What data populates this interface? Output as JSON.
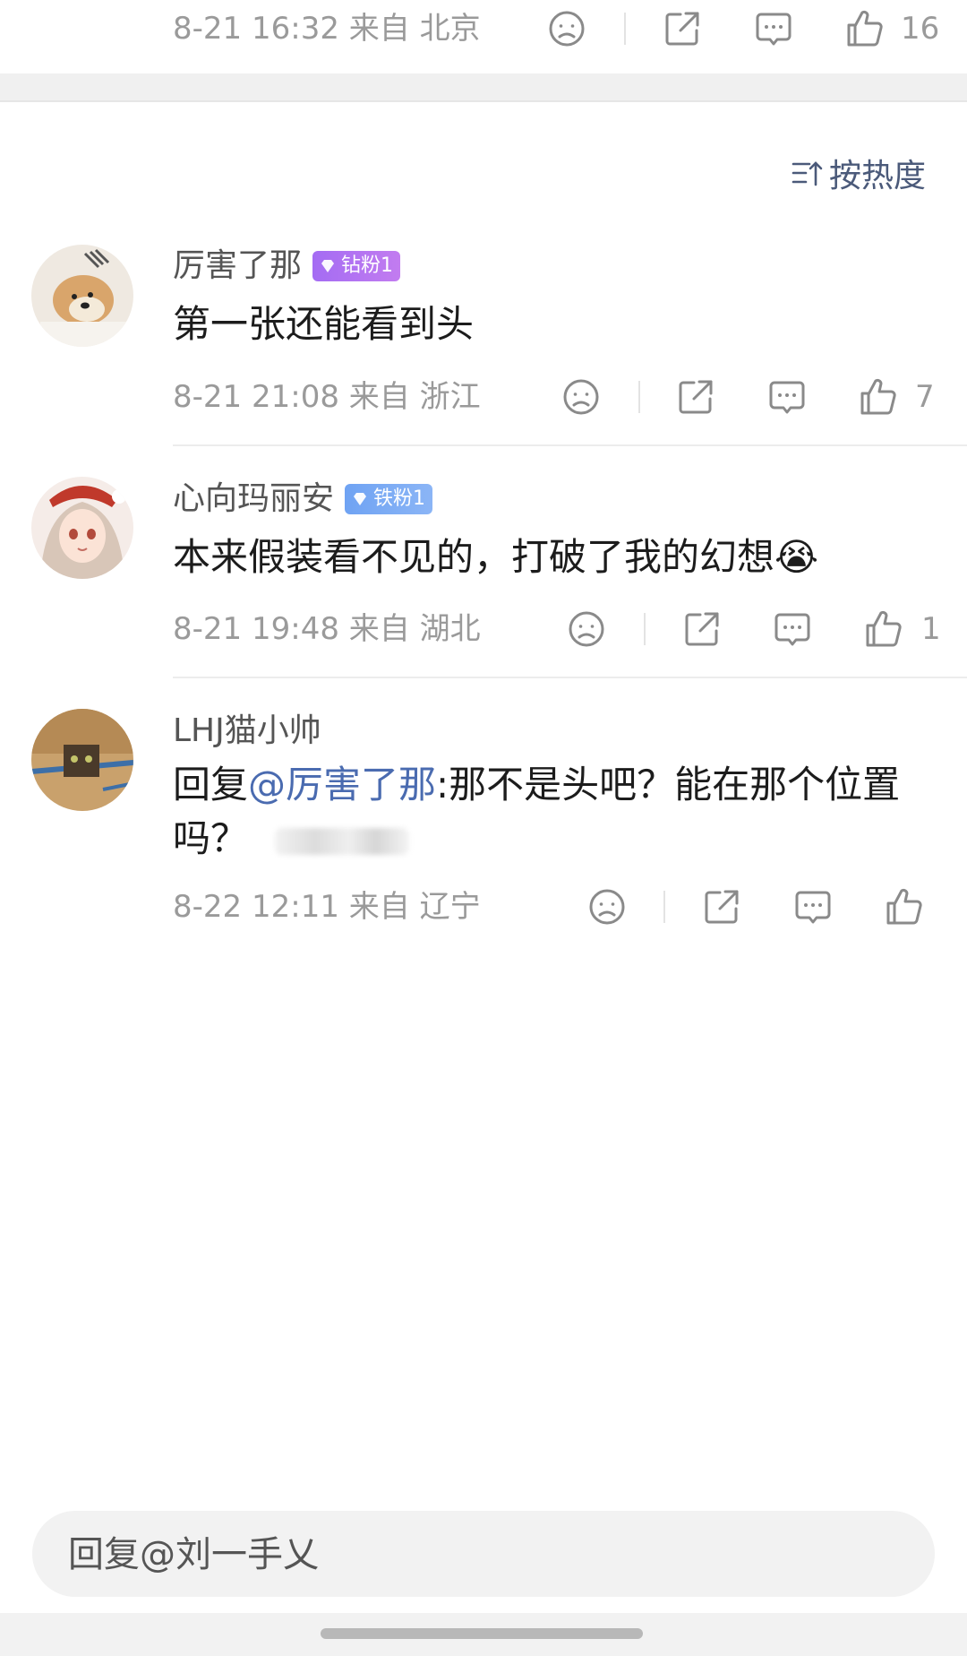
{
  "top_post": {
    "meta": "8-21 16:32  来自 北京",
    "like_count": "16"
  },
  "sort": {
    "label": "按热度"
  },
  "comments": [
    {
      "username": "厉害了那",
      "badge": "钻粉1",
      "badge_color": "#a46cf3",
      "text": "第一张还能看到头",
      "meta": "8-21 21:08  来自 浙江",
      "like_count": "7"
    },
    {
      "username": "心向玛丽安",
      "badge": "铁粉1",
      "badge_color": "#6fa3f3",
      "text": "本来假装看不见的，打破了我的幻想",
      "emoji": "😭",
      "meta": "8-21 19:48  来自 湖北",
      "like_count": "1"
    },
    {
      "username": "LHJ猫小帅",
      "reply_prefix": "回复",
      "mention": "@厉害了那",
      "text_after": ":那不是头吧？能在那个位置吗？",
      "meta": "8-22 12:11  来自 辽宁",
      "like_count": ""
    }
  ],
  "reply_input": {
    "placeholder": "回复@刘一手乂"
  },
  "colors": {
    "accent_link": "#4a6bb0",
    "meta_gray": "#9a9a9a"
  },
  "icons": [
    "sad-face-icon",
    "share-icon",
    "comment-icon",
    "thumbs-up-icon",
    "sort-icon",
    "diamond-icon"
  ]
}
